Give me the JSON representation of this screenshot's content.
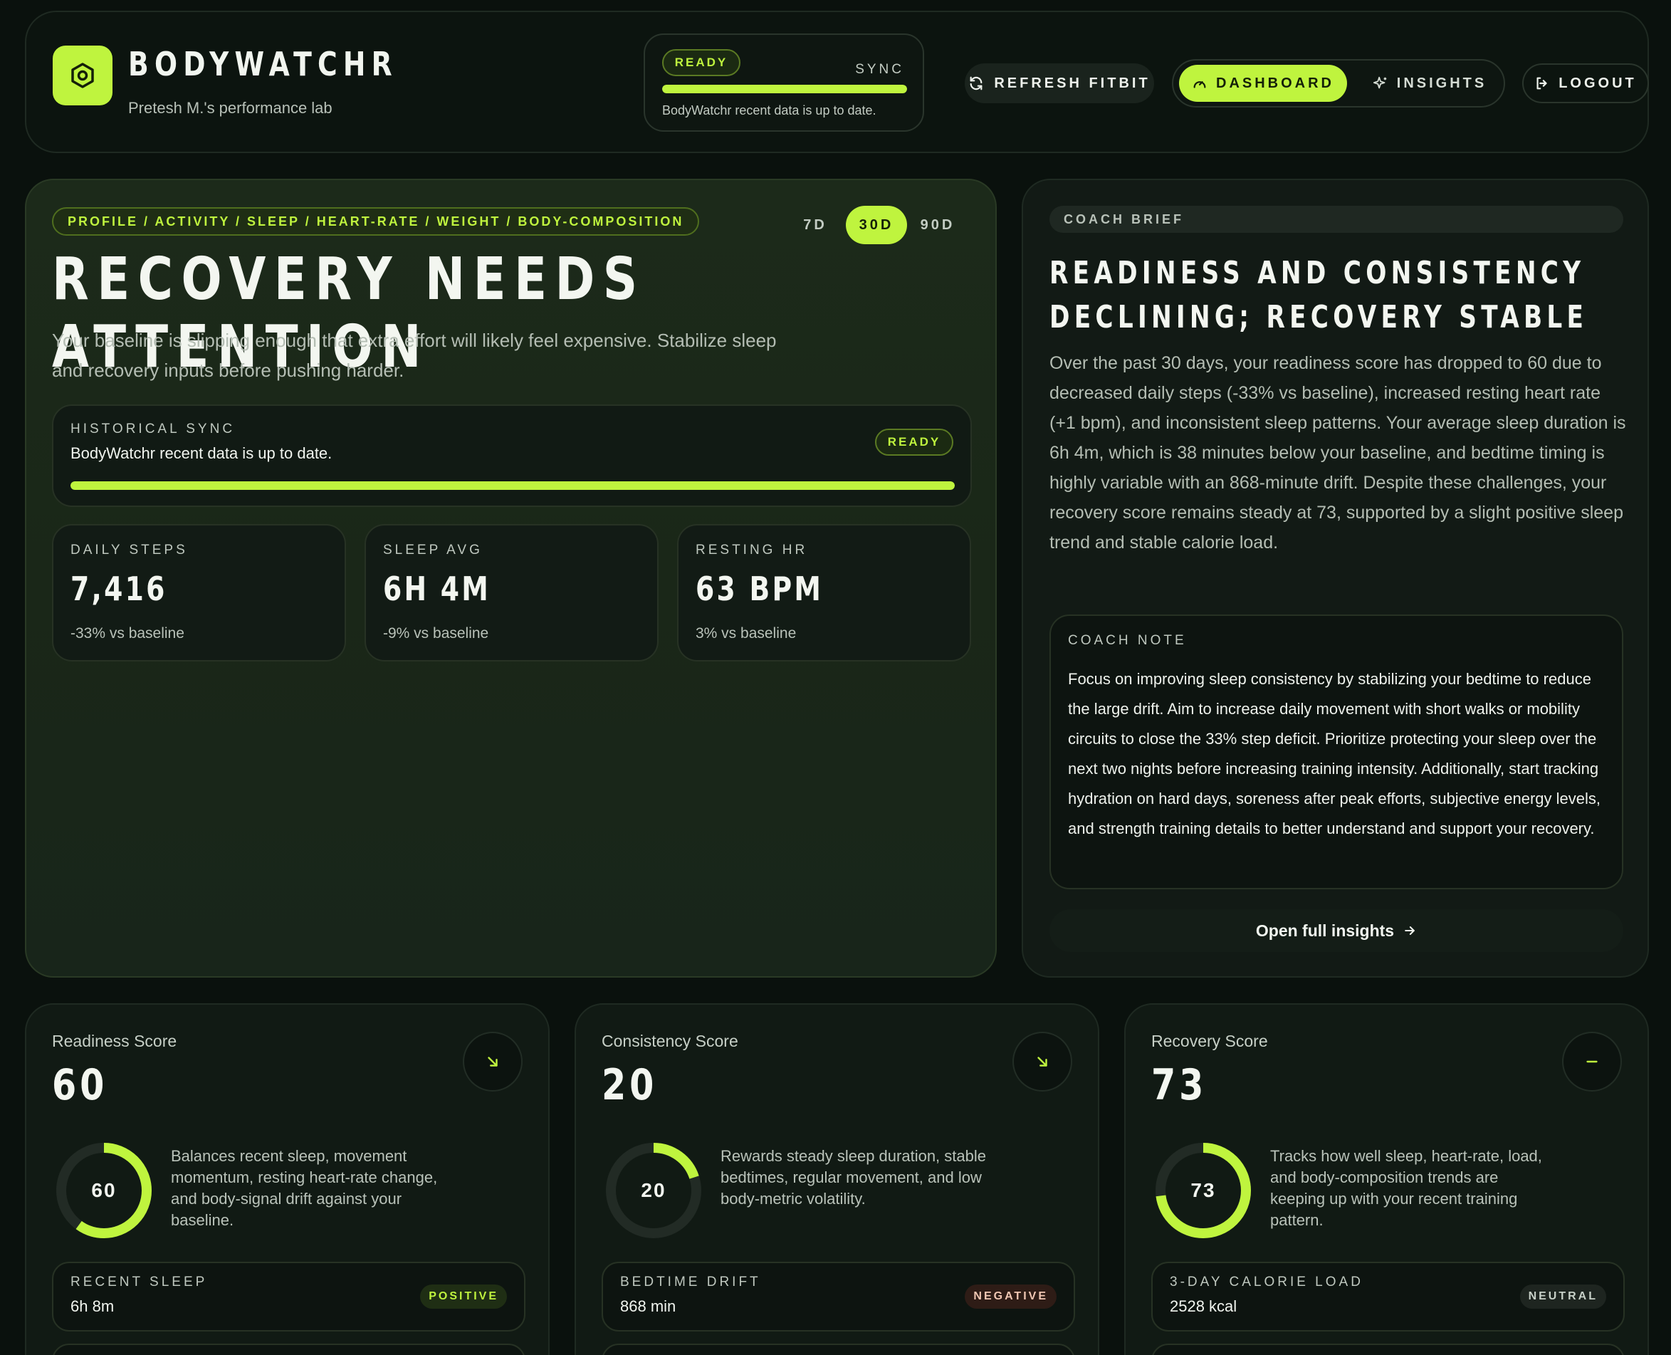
{
  "header": {
    "brand": "BODYWATCHR",
    "subtitle": "Pretesh M.'s performance lab",
    "sync_status": "READY",
    "sync_label": "SYNC",
    "sync_progress": 1.0,
    "sync_text": "BodyWatchr recent data is up to date.",
    "refresh_label": "REFRESH FITBIT",
    "nav": {
      "dashboard": "DASHBOARD",
      "insights": "INSIGHTS"
    },
    "logout_label": "LOGOUT"
  },
  "hero": {
    "tag": "PROFILE / ACTIVITY / SLEEP / HEART-RATE / WEIGHT / BODY-COMPOSITION",
    "ranges": [
      "7D",
      "30D",
      "90D"
    ],
    "active_range": "30D",
    "title": "RECOVERY NEEDS ATTENTION",
    "description": "Your baseline is slipping enough that extra effort will likely feel expensive. Stabilize sleep and recovery inputs before pushing harder.",
    "historical_sync": {
      "label": "HISTORICAL SYNC",
      "text": "BodyWatchr recent data is up to date.",
      "status": "READY",
      "progress": 1.0
    },
    "stats": [
      {
        "label": "DAILY STEPS",
        "value": "7,416",
        "delta": "-33% vs baseline"
      },
      {
        "label": "SLEEP AVG",
        "value": "6H 4M",
        "delta": "-9% vs baseline"
      },
      {
        "label": "RESTING HR",
        "value": "63 BPM",
        "delta": "3% vs baseline"
      }
    ]
  },
  "coach": {
    "pill": "COACH BRIEF",
    "title": "READINESS AND CONSISTENCY DECLINING; RECOVERY STABLE",
    "body": "Over the past 30 days, your readiness score has dropped to 60 due to decreased daily steps (-33% vs baseline), increased resting heart rate (+1 bpm), and inconsistent sleep patterns. Your average sleep duration is 6h 4m, which is 38 minutes below your baseline, and bedtime timing is highly variable with an 868-minute drift. Despite these challenges, your recovery score remains steady at 73, supported by a slight positive sleep trend and stable calorie load.",
    "note_label": "COACH NOTE",
    "note_text": "Focus on improving sleep consistency by stabilizing your bedtime to reduce the large drift. Aim to increase daily movement with short walks or mobility circuits to close the 33% step deficit. Prioritize protecting your sleep over the next two nights before increasing training intensity. Additionally, start tracking hydration on hard days, soreness after peak efforts, subjective energy levels, and strength training details to better understand and support your recovery.",
    "open_label": "Open full insights"
  },
  "scores": [
    {
      "name": "Readiness Score",
      "value": "60",
      "score": 60,
      "trend": "down-right-arrow-icon",
      "description": "Balances recent sleep, movement momentum, resting heart-rate change, and body-signal drift against your baseline.",
      "sub_label": "RECENT SLEEP",
      "sub_value": "6h 8m",
      "badge": "POSITIVE",
      "badge_type": "pos"
    },
    {
      "name": "Consistency Score",
      "value": "20",
      "score": 20,
      "trend": "down-right-arrow-icon",
      "description": "Rewards steady sleep duration, stable bedtimes, regular movement, and low body-metric volatility.",
      "sub_label": "BEDTIME DRIFT",
      "sub_value": "868 min",
      "badge": "NEGATIVE",
      "badge_type": "neg"
    },
    {
      "name": "Recovery Score",
      "value": "73",
      "score": 73,
      "trend": "dash-icon",
      "description": "Tracks how well sleep, heart-rate, load, and body-composition trends are keeping up with your recent training pattern.",
      "sub_label": "3-DAY CALORIE LOAD",
      "sub_value": "2528 kcal",
      "badge": "NEUTRAL",
      "badge_type": "neu"
    }
  ],
  "colors": {
    "accent": "#bff43e",
    "background": "#0a110d"
  }
}
